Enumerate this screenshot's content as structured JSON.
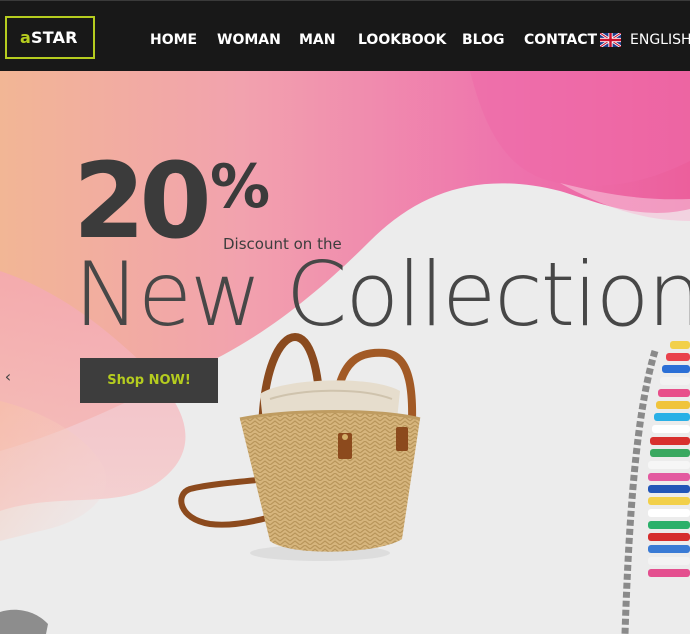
{
  "header": {
    "logo": {
      "accent": "a",
      "rest": "STAR"
    },
    "nav": [
      {
        "label": "HOME"
      },
      {
        "label": "WOMAN"
      },
      {
        "label": "MAN"
      },
      {
        "label": "LOOKBOOK"
      },
      {
        "label": "BLOG"
      },
      {
        "label": "CONTACT"
      }
    ],
    "language": {
      "label": "ENGLISH",
      "icon": "uk-flag-icon"
    }
  },
  "hero": {
    "big_number": "20",
    "percent": "%",
    "discount_text": "Discount on the",
    "headline": "New Collection",
    "cta_label": "Shop NOW!",
    "prev_arrow": "‹"
  },
  "colors": {
    "header_bg": "#181818",
    "accent": "#b5cc1f",
    "button_bg": "#3d3d3d",
    "hero_pink": "#ef6aa6",
    "hero_peach": "#f0b29a",
    "hero_bg": "#ecebeb"
  }
}
